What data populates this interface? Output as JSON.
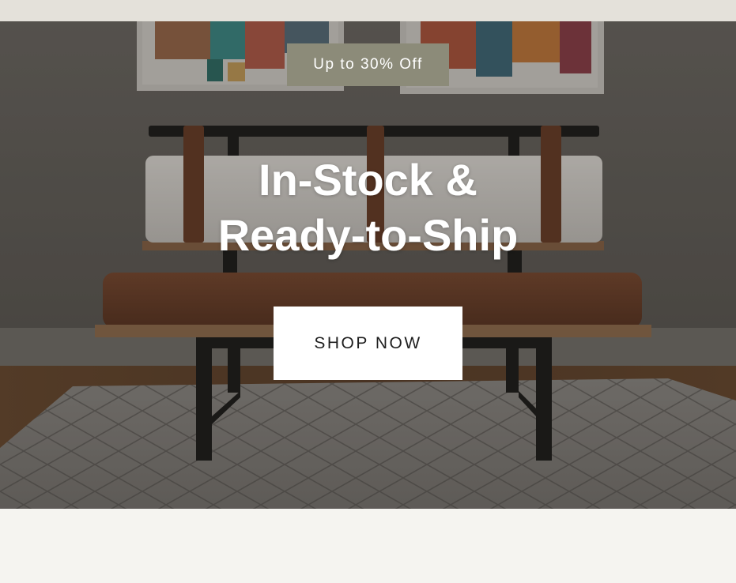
{
  "promo": {
    "badge_text": "Up to 30% Off"
  },
  "hero": {
    "headline_line1": "In-Stock &",
    "headline_line2": "Ready-to-Ship",
    "cta_label": "SHOP NOW"
  },
  "colors": {
    "badge_bg": "#8c8b79",
    "button_bg": "#ffffff",
    "button_text": "#1f1f1f",
    "headline_text": "#ffffff"
  }
}
